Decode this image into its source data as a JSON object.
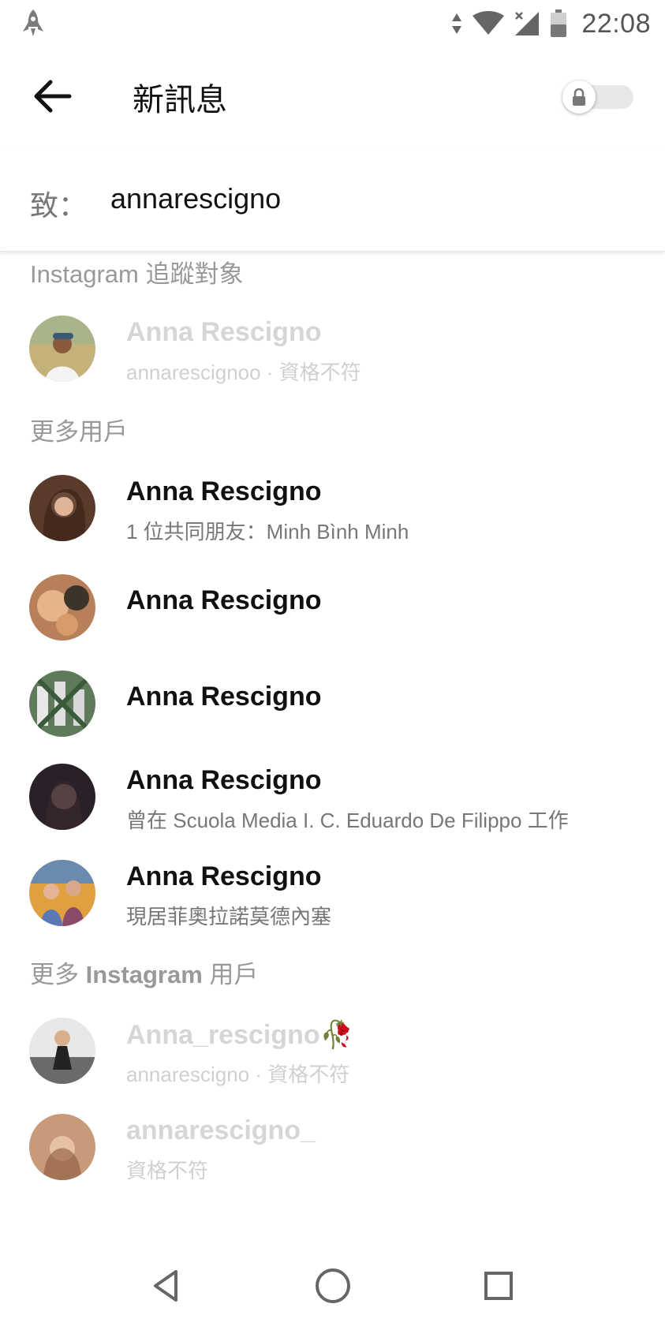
{
  "status_bar": {
    "time": "22:08",
    "icons": [
      "rocket-icon",
      "data-arrows-icon",
      "wifi-icon",
      "no-signal-icon",
      "battery-icon"
    ]
  },
  "header": {
    "title": "新訊息",
    "back_icon": "arrow-left-icon",
    "secret_toggle_icon": "lock-icon",
    "secret_toggle_on": false
  },
  "recipient": {
    "label": "致：",
    "value": "annarescigno"
  },
  "sections": {
    "instagram_following": "Instagram 追蹤對象",
    "more_users": "更多用戶",
    "more_instagram_prefix": "更多 ",
    "more_instagram_bold": "Instagram",
    "more_instagram_suffix": " 用戶"
  },
  "contacts": [
    {
      "name": "Anna Rescigno",
      "subtitle": "annarescignoo · 資格不符",
      "disabled": true
    },
    {
      "name": "Anna Rescigno",
      "subtitle": "1 位共同朋友：Minh Bình Minh",
      "disabled": false
    },
    {
      "name": "Anna Rescigno",
      "subtitle": "",
      "disabled": false
    },
    {
      "name": "Anna Rescigno",
      "subtitle": "",
      "disabled": false
    },
    {
      "name": "Anna Rescigno",
      "subtitle": "曾在 Scuola Media I. C. Eduardo De Filippo 工作",
      "disabled": false
    },
    {
      "name": "Anna Rescigno",
      "subtitle": "現居菲奧拉諾莫德內塞",
      "disabled": false
    },
    {
      "name": "Anna_rescigno",
      "name_emoji": "🥀",
      "subtitle": "annarescigno · 資格不符",
      "disabled": true
    },
    {
      "name": "annarescigno_",
      "subtitle": "資格不符",
      "disabled": true
    }
  ],
  "nav_bar": {
    "icons": [
      "back-triangle-icon",
      "home-circle-icon",
      "recents-square-icon"
    ]
  }
}
